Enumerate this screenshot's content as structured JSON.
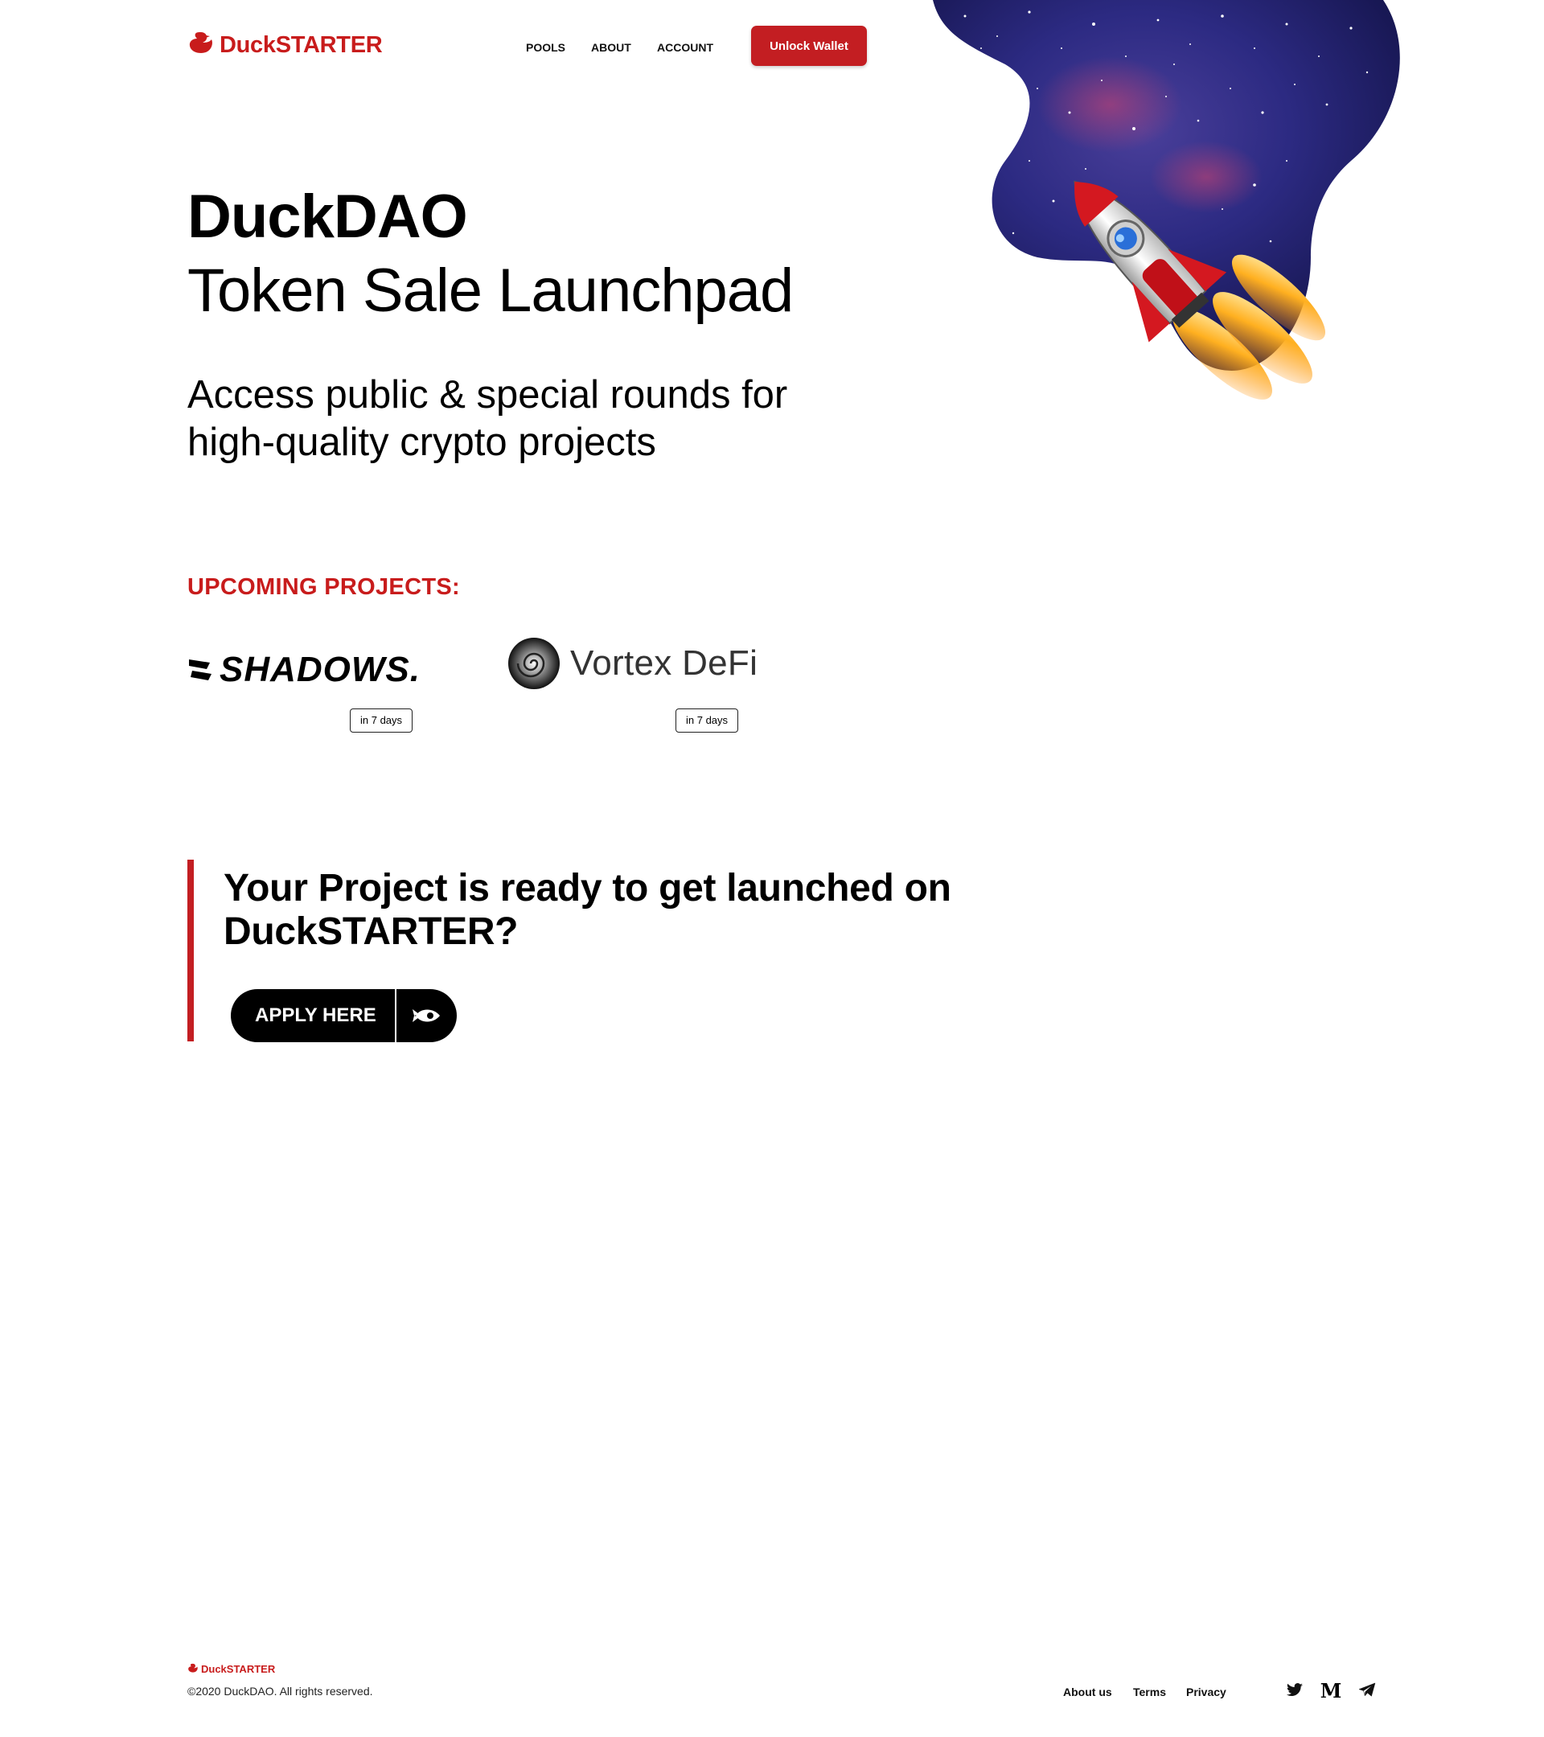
{
  "header": {
    "brand": "DuckSTARTER",
    "nav": [
      "POOLS",
      "ABOUT",
      "ACCOUNT"
    ],
    "unlock_label": "Unlock Wallet"
  },
  "hero": {
    "title": "DuckDAO",
    "subtitle": "Token Sale Launchpad",
    "description": "Access public & special rounds for high-quality crypto projects"
  },
  "upcoming": {
    "heading": "UPCOMING PROJECTS:",
    "projects": [
      {
        "name": "SHADOWS.",
        "badge": "in 7 days"
      },
      {
        "name": "Vortex DeFi",
        "badge": "in 7 days"
      }
    ]
  },
  "cta": {
    "title": "Your Project is ready to get launched on DuckSTARTER?",
    "button_label": "APPLY HERE"
  },
  "footer": {
    "brand": "DuckSTARTER",
    "copyright": "©2020 DuckDAO. All rights reserved.",
    "links": [
      "About us",
      "Terms",
      "Privacy"
    ],
    "social_icons": [
      "twitter-icon",
      "medium-icon",
      "telegram-icon"
    ],
    "medium_glyph": "M"
  },
  "colors": {
    "brand_red": "#c31e22",
    "text": "#000000",
    "background": "#ffffff"
  }
}
